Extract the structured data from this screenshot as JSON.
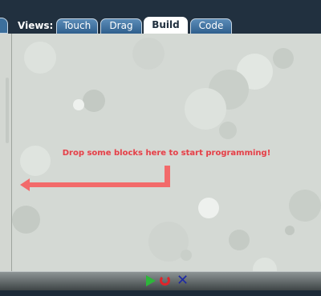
{
  "header": {
    "views_label": "Views:",
    "tabs": [
      {
        "label": "Touch",
        "active": false
      },
      {
        "label": "Drag",
        "active": false
      },
      {
        "label": "Build",
        "active": true
      },
      {
        "label": "Code",
        "active": false
      }
    ]
  },
  "workspace": {
    "hint": "Drop some blocks here to start programming!"
  },
  "controls": {
    "run_icon": "play-icon",
    "reset_icon": "reset-icon",
    "stop_icon": "stop-icon",
    "stop_glyph": "✕"
  },
  "colors": {
    "header_bg": "#21303f",
    "tab_active_bg": "#ffffff",
    "tab_bg": "#3c6f9c",
    "workspace_bg": "#d4d9d4",
    "hint_text": "#e0434a",
    "arrow": "#f26a6a",
    "run": "#2db63a",
    "reset": "#e1252b",
    "stop": "#1e2aa4"
  }
}
